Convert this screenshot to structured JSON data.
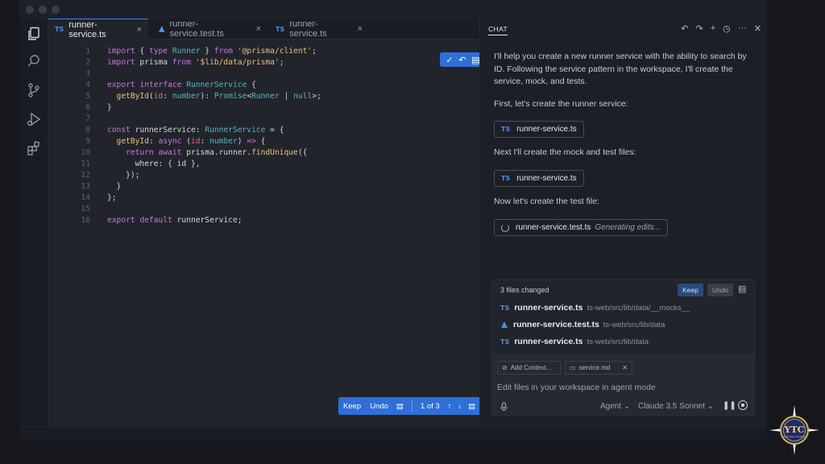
{
  "editor": {
    "tabs": [
      {
        "badge": "TS",
        "label": "runner-service.ts",
        "close": "×"
      },
      {
        "badge": "",
        "label": "runner-service.test.ts",
        "close": "×"
      },
      {
        "badge": "TS",
        "label": "runner-service.ts",
        "close": "×"
      }
    ],
    "code_lines": [
      "1",
      "2",
      "3",
      "4",
      "5",
      "6",
      "7",
      "8",
      "9",
      "10",
      "11",
      "12",
      "13",
      "14",
      "15",
      "16"
    ],
    "code": {
      "l1a": "import",
      "l1b": " { ",
      "l1c": "type",
      "l1d": " ",
      "l1e": "Runner",
      "l1f": " } ",
      "l1g": "from",
      "l1h": " ",
      "l1i": "'@prisma/client'",
      "l1j": ";",
      "l2a": "import",
      "l2b": " prisma ",
      "l2c": "from",
      "l2d": " ",
      "l2e": "'$lib/data/prisma'",
      "l2f": ";",
      "l4a": "export",
      "l4b": " ",
      "l4c": "interface",
      "l4d": " ",
      "l4e": "RunnerService",
      "l4f": " {",
      "l5a": "  getById",
      "l5b": "(",
      "l5c": "id",
      "l5d": ": ",
      "l5e": "number",
      "l5f": "): ",
      "l5g": "Promise",
      "l5h": "<",
      "l5i": "Runner",
      "l5j": " | ",
      "l5k": "null",
      "l5l": ">;",
      "l6a": "}",
      "l8a": "const",
      "l8b": " runnerService: ",
      "l8c": "RunnerService",
      "l8d": " = {",
      "l9a": "  getById",
      "l9b": ": ",
      "l9c": "async",
      "l9d": " (",
      "l9e": "id",
      "l9f": ": ",
      "l9g": "number",
      "l9h": ") ",
      "l9i": "=>",
      "l9j": " {",
      "l10a": "    return",
      "l10b": " ",
      "l10c": "await",
      "l10d": " prisma.runner.",
      "l10e": "findUnique",
      "l10f": "({",
      "l11a": "      where: { id },",
      "l12a": "    });",
      "l13a": "  }",
      "l14a": "};",
      "l16a": "export",
      "l16b": " ",
      "l16c": "default",
      "l16d": " runnerService;"
    },
    "float_bar": {
      "check": "✓",
      "undo": "↶",
      "file": "▤"
    },
    "keep_bar": {
      "keep": "Keep",
      "undo": "Undo",
      "counter": "1 of 3",
      "up": "↑",
      "down": "↓"
    }
  },
  "chat": {
    "title": "CHAT",
    "actions": {
      "undo": "↶",
      "redo": "↷",
      "new": "+",
      "history": "◷",
      "more": "···",
      "close": "✕"
    },
    "messages": [
      "I'll help you create a new runner service with the ability to search by ID. Following the service pattern in the workspace, I'll create the service, mock, and tests.",
      "First, let's create the runner service:",
      "Next I'll create the mock and test files:",
      "Now let's create the test file:"
    ],
    "chips": [
      {
        "badge": "TS",
        "label": "runner-service.ts"
      },
      {
        "badge": "TS",
        "label": "runner-service.ts"
      },
      {
        "label": "runner-service.test.ts",
        "status": "Generating edits..."
      }
    ],
    "changes": {
      "header": "3 files changed",
      "keep": "Keep",
      "undo": "Undo",
      "files": [
        {
          "badge": "TS",
          "name": "runner-service.ts",
          "path": "ts-web/src/lib/data/__mocks__"
        },
        {
          "badge": "",
          "name": "runner-service.test.ts",
          "path": "ts-web/src/lib/data"
        },
        {
          "badge": "TS",
          "name": "runner-service.ts",
          "path": "ts-web/src/lib/data"
        }
      ]
    },
    "input": {
      "add_context": "Add Context...",
      "attached_file": "service.md",
      "remove": "✕",
      "placeholder": "Edit files in your workspace in agent mode",
      "mode": "Agent",
      "model": "Claude 3.5 Sonnet"
    }
  },
  "logo": {
    "text": "YTC",
    "subtitle": "Your Tech Company"
  },
  "colors": {
    "accent": "#2f6fd8",
    "ts_badge": "#4a8fe7"
  }
}
